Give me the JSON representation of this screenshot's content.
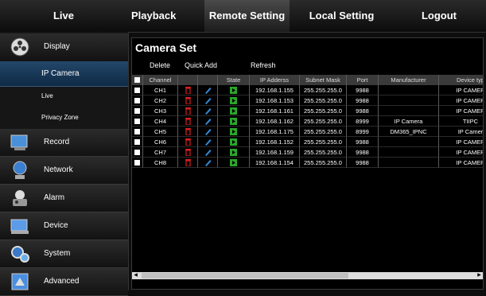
{
  "top_nav": [
    {
      "label": "Live"
    },
    {
      "label": "Playback"
    },
    {
      "label": "Remote Setting"
    },
    {
      "label": "Local Setting"
    },
    {
      "label": "Logout"
    }
  ],
  "sidebar": {
    "items": [
      {
        "label": "Display",
        "icon": "display-icon"
      },
      {
        "label": "Record",
        "icon": "record-icon"
      },
      {
        "label": "Network",
        "icon": "network-icon"
      },
      {
        "label": "Alarm",
        "icon": "alarm-icon"
      },
      {
        "label": "Device",
        "icon": "device-icon"
      },
      {
        "label": "System",
        "icon": "system-icon"
      },
      {
        "label": "Advanced",
        "icon": "advanced-icon"
      }
    ],
    "sub_items": [
      {
        "label": "IP Camera"
      },
      {
        "label": "Live"
      },
      {
        "label": "Privacy Zone"
      }
    ]
  },
  "panel": {
    "title": "Camera Set",
    "toolbar": {
      "delete": "Delete",
      "quick_add": "Quick Add",
      "refresh": "Refresh"
    },
    "columns": [
      "Channel",
      "",
      "",
      "State",
      "IP Adderss",
      "Subnet Mask",
      "Port",
      "Manufacturer",
      "Device typ"
    ],
    "rows": [
      {
        "channel": "CH1",
        "ip": "192.168.1.155",
        "mask": "255.255.255.0",
        "port": "9988",
        "manufacturer": "",
        "device": "IP CAMER"
      },
      {
        "channel": "CH2",
        "ip": "192.168.1.153",
        "mask": "255.255.255.0",
        "port": "9988",
        "manufacturer": "",
        "device": "IP CAMER"
      },
      {
        "channel": "CH3",
        "ip": "192.168.1.161",
        "mask": "255.255.255.0",
        "port": "9988",
        "manufacturer": "",
        "device": "IP CAMER"
      },
      {
        "channel": "CH4",
        "ip": "192.168.1.162",
        "mask": "255.255.255.0",
        "port": "8999",
        "manufacturer": "IP Camera",
        "device": "TIIPC"
      },
      {
        "channel": "CH5",
        "ip": "192.168.1.175",
        "mask": "255.255.255.0",
        "port": "8999",
        "manufacturer": "DM365_IPNC",
        "device": "IP Camer"
      },
      {
        "channel": "CH6",
        "ip": "192.168.1.152",
        "mask": "255.255.255.0",
        "port": "9988",
        "manufacturer": "",
        "device": "IP CAMER"
      },
      {
        "channel": "CH7",
        "ip": "192.168.1.159",
        "mask": "255.255.255.0",
        "port": "9988",
        "manufacturer": "",
        "device": "IP CAMER"
      },
      {
        "channel": "CH8",
        "ip": "192.168.1.154",
        "mask": "255.255.255.0",
        "port": "9988",
        "manufacturer": "",
        "device": "IP CAMER"
      }
    ],
    "icons": {
      "delete": "trash-icon",
      "edit": "pencil-icon",
      "state": "play-icon"
    },
    "colors": {
      "delete": "#d42020",
      "edit": "#2f8fe0",
      "state": "#2aa82a",
      "active_tab": "#1f4a75"
    }
  }
}
